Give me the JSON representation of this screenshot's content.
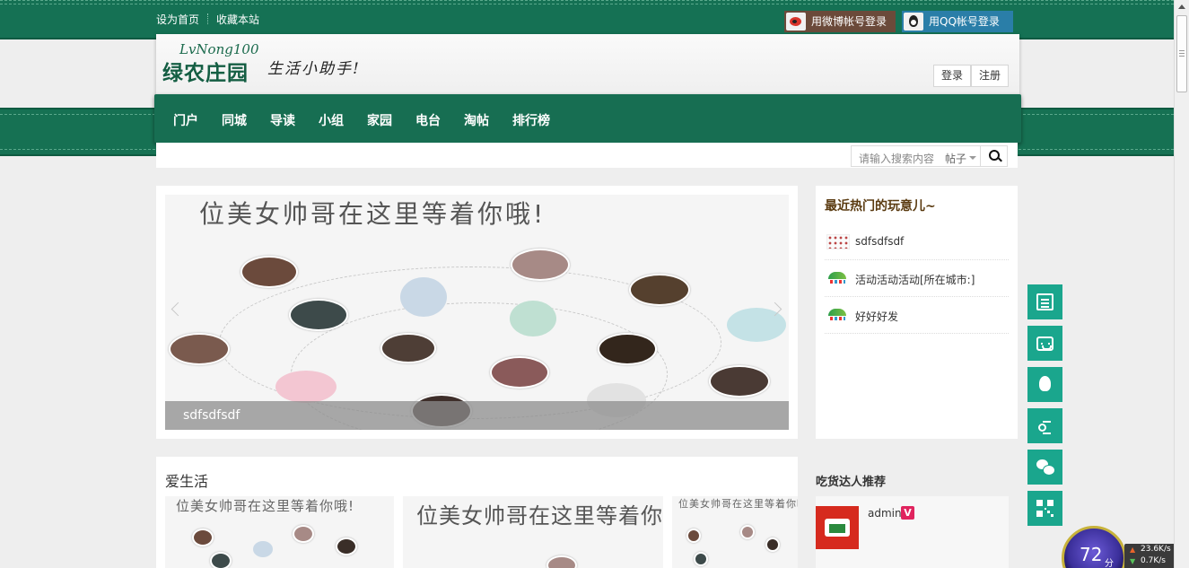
{
  "topbar": {
    "set_home": "设为首页",
    "bookmark": "收藏本站",
    "weibo_login": "用微博帐号登录",
    "qq_login": "用QQ帐号登录"
  },
  "header": {
    "logo_en": "LvNong100",
    "logo_cn": "绿农庄园",
    "slogan": "生活小助手!",
    "login": "登录",
    "register": "注册"
  },
  "nav": {
    "items": [
      "门户",
      "同城",
      "导读",
      "小组",
      "家园",
      "电台",
      "淘帖",
      "排行榜"
    ]
  },
  "search": {
    "placeholder": "请输入搜索内容",
    "scope": "帖子"
  },
  "slider": {
    "headline": "位美女帅哥在这里等着你哦!",
    "caption": "sdfsdfsdf"
  },
  "hot": {
    "title": "最近热门的玩意儿~",
    "items": [
      "sdfsdfsdf",
      "活动活动活动[所在城市:]",
      "好好好发"
    ]
  },
  "life": {
    "title": "爱生活",
    "thumb_text": "位美女帅哥在这里等着你哦!"
  },
  "foodie": {
    "title": "吃货达人推荐",
    "name": "admin",
    "badge": "V"
  },
  "speed": {
    "score": "72",
    "score_unit": "分",
    "upload": "23.6K/s",
    "download": "0.7K/s"
  },
  "colors": {
    "brand_green": "#157154",
    "tool_teal": "#1aa68d",
    "weibo_brown": "#6b4a3a",
    "qq_blue": "#2a7ea8"
  }
}
